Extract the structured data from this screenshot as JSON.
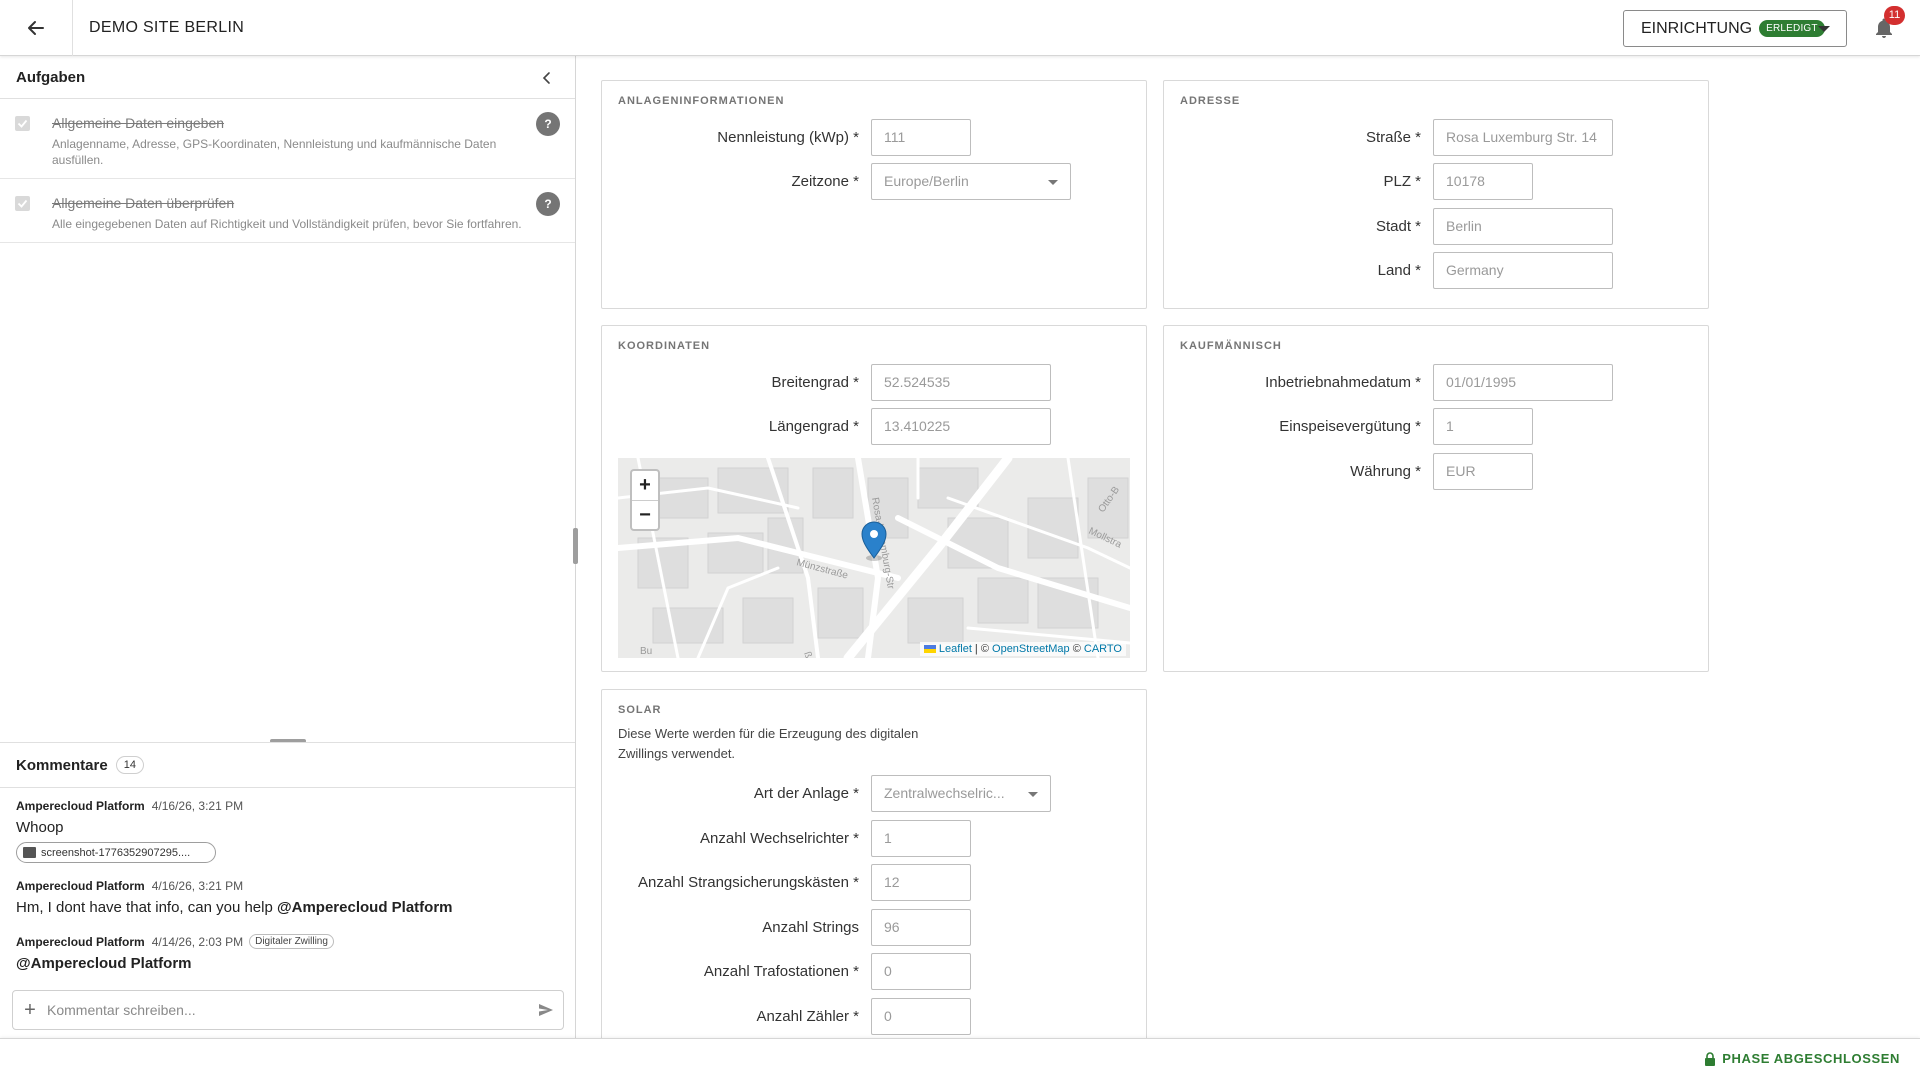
{
  "header": {
    "site_title": "DEMO SITE BERLIN",
    "phase_label": "EINRICHTUNG",
    "phase_status": "ERLEDIGT",
    "notification_count": "11"
  },
  "tasks": {
    "title": "Aufgaben",
    "items": [
      {
        "title": "Allgemeine Daten eingeben",
        "description": "Anlagenname, Adresse, GPS-Koordinaten, Nennleistung und kaufmännische Daten ausfüllen.",
        "help": "?"
      },
      {
        "title": "Allgemeine Daten überprüfen",
        "description": "Alle eingegebenen Daten auf Richtigkeit und Vollständigkeit prüfen, bevor Sie fortfahren.",
        "help": "?"
      }
    ]
  },
  "comments": {
    "title": "Kommentare",
    "count": "14",
    "items": [
      {
        "author": "Amperecloud Platform",
        "date": "4/16/26, 3:21 PM",
        "text": "Whoop",
        "attachment": "screenshot-1776352907295...."
      },
      {
        "author": "Amperecloud Platform",
        "date": "4/16/26, 3:21 PM",
        "text": "Hm, I dont have that info, can you help ",
        "mention": "@Amperecloud Platform"
      },
      {
        "author": "Amperecloud Platform",
        "date": "4/14/26, 2:03 PM",
        "tag": "Digitaler Zwilling",
        "mention": "@Amperecloud Platform"
      }
    ],
    "input_placeholder": "Kommentar schreiben..."
  },
  "anlageninformationen": {
    "title": "ANLAGENINFORMATIONEN",
    "nennleistung_label": "Nennleistung (kWp) *",
    "nennleistung_value": "111",
    "zeitzone_label": "Zeitzone *",
    "zeitzone_value": "Europe/Berlin"
  },
  "adresse": {
    "title": "ADRESSE",
    "strasse_label": "Straße *",
    "strasse_value": "Rosa Luxemburg Str. 14",
    "plz_label": "PLZ *",
    "plz_value": "10178",
    "stadt_label": "Stadt *",
    "stadt_value": "Berlin",
    "land_label": "Land *",
    "land_value": "Germany"
  },
  "koordinaten": {
    "title": "KOORDINATEN",
    "breitengrad_label": "Breitengrad *",
    "breitengrad_value": "52.524535",
    "laengengrad_label": "Längengrad *",
    "laengengrad_value": "13.410225",
    "map": {
      "zoom_in": "+",
      "zoom_out": "−",
      "attribution_leaflet": "Leaflet",
      "attribution_sep": " | © ",
      "attribution_osm": "OpenStreetMap",
      "attribution_copy": " © ",
      "attribution_carto": "CARTO",
      "street_labels": [
        "Münzstraße",
        "Rosa-Luxemburg-Str",
        "Otto-B",
        "Mollstra",
        "Alte Schönhauser Str",
        "ße",
        "Bu"
      ]
    }
  },
  "kaufmaennisch": {
    "title": "KAUFMÄNNISCH",
    "inbetrieb_label": "Inbetriebnahmedatum *",
    "inbetrieb_value": "01/01/1995",
    "einspeise_label": "Einspeisevergütung *",
    "einspeise_value": "1",
    "waehrung_label": "Währung *",
    "waehrung_value": "EUR"
  },
  "solar": {
    "title": "SOLAR",
    "description": "Diese Werte werden für die Erzeugung des digitalen Zwillings verwendet.",
    "art_label": "Art der Anlage *",
    "art_value": "Zentralwechselric...",
    "wechselrichter_label": "Anzahl Wechselrichter *",
    "wechselrichter_value": "1",
    "strangsicherung_label": "Anzahl Strangsicherungskästen *",
    "strangsicherung_value": "12",
    "strings_label": "Anzahl Strings",
    "strings_value": "96",
    "trafo_label": "Anzahl Trafostationen *",
    "trafo_value": "0",
    "zaehler_label": "Anzahl Zähler *",
    "zaehler_value": "0"
  },
  "footer": {
    "status": "PHASE ABGESCHLOSSEN"
  },
  "colors": {
    "success": "#2e7d32",
    "badge": "#d32f2f",
    "link": "#0078a8"
  }
}
